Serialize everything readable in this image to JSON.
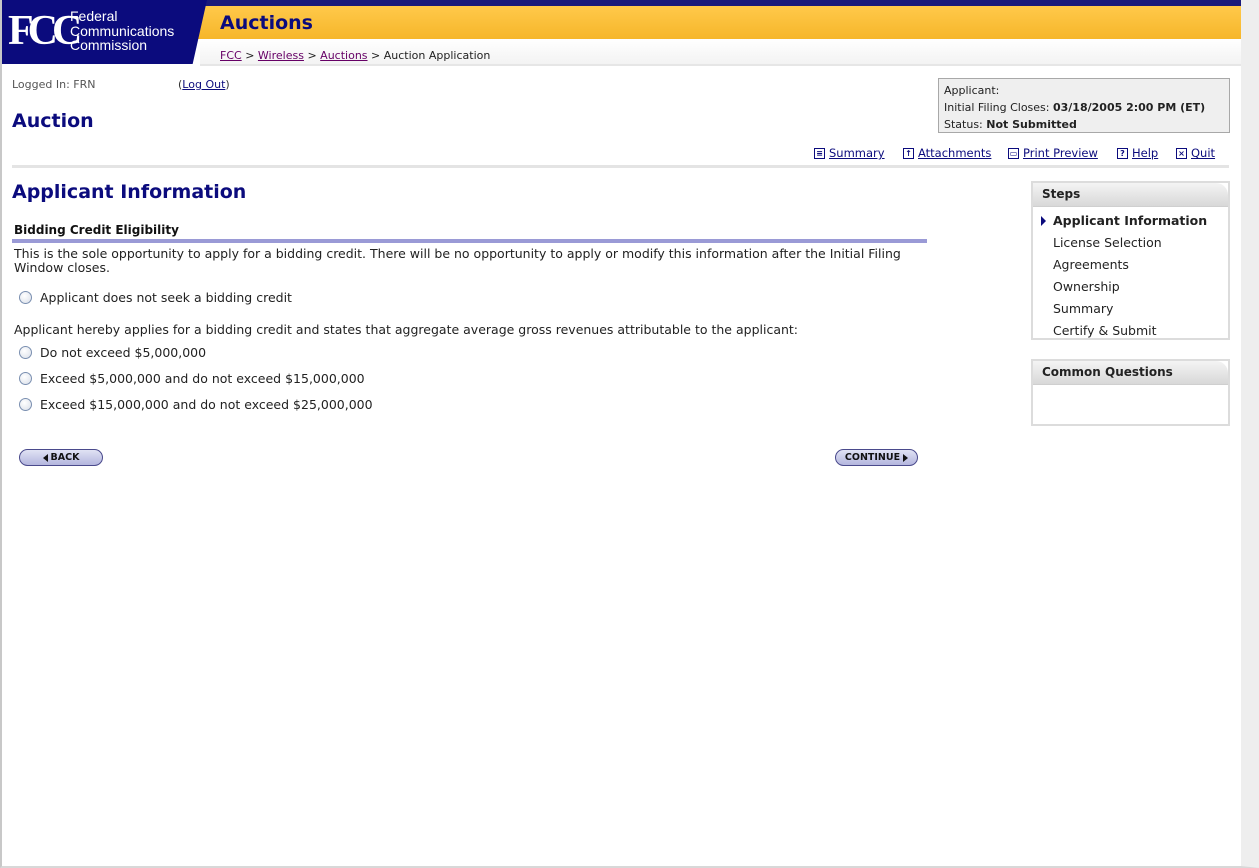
{
  "header": {
    "logo_letters": "FCC",
    "agency_lines": [
      "Federal",
      "Communications",
      "Commission"
    ],
    "title": "Auctions",
    "breadcrumb": {
      "links": [
        "FCC",
        "Wireless",
        "Auctions"
      ],
      "separator": ">",
      "current": "Auction Application"
    }
  },
  "session": {
    "logged_in": "Logged In: FRN",
    "logout_label": "Log Out",
    "logout_open": "(",
    "logout_close": ")"
  },
  "page_title": "Auction",
  "status_box": {
    "applicant_label": "Applicant:",
    "filing_label": "Initial Filing Closes:",
    "filing_value": "03/18/2005 2:00 PM (ET)",
    "status_label": "Status:",
    "status_value": "Not Submitted"
  },
  "toolbar": {
    "items": [
      {
        "label": "Summary",
        "icon": "summary-icon"
      },
      {
        "label": "Attachments",
        "icon": "attachments-icon"
      },
      {
        "label": "Print Preview",
        "icon": "printer-icon"
      },
      {
        "label": "Help",
        "icon": "help-icon"
      },
      {
        "label": "Quit",
        "icon": "quit-icon"
      }
    ]
  },
  "section": {
    "title": "Applicant Information",
    "subheading": "Bidding Credit Eligibility",
    "intro": "This is the sole opportunity to apply for a bidding credit. There will be no opportunity to apply or modify this information after the Initial Filing Window closes.",
    "no_credit_option": "Applicant does not seek a bidding credit",
    "statement": "Applicant hereby applies for a bidding credit and states that aggregate average gross revenues attributable to the applicant:",
    "options": [
      "Do not exceed $5,000,000",
      "Exceed $5,000,000 and do not exceed $15,000,000",
      "Exceed $15,000,000 and do not exceed $25,000,000"
    ]
  },
  "buttons": {
    "back": "BACK",
    "continue": "CONTINUE"
  },
  "steps": {
    "title": "Steps",
    "items": [
      "Applicant Information",
      "License Selection",
      "Agreements",
      "Ownership",
      "Summary",
      "Certify & Submit"
    ],
    "active": "Applicant Information"
  },
  "common_questions": {
    "title": "Common Questions"
  },
  "colors": {
    "brand_navy": "#0b0b7d",
    "header_gold": "#f6b62a",
    "rule_lavender": "#9a9ad6"
  }
}
